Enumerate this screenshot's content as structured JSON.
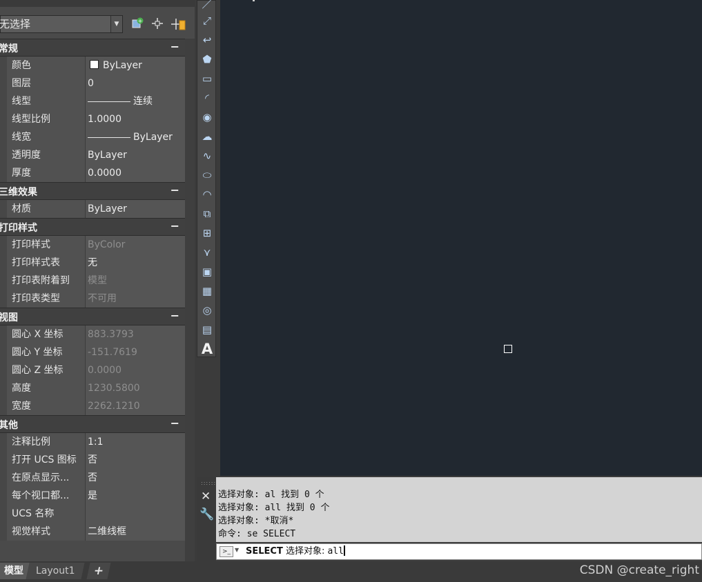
{
  "quick_select": {
    "value": "无选择"
  },
  "toolbar_icons": [
    "add-selected-icon",
    "select-objects-icon",
    "quick-select-icon"
  ],
  "properties": {
    "sections": [
      {
        "title": "常规",
        "collapse": "−",
        "rows": [
          {
            "key": "颜色",
            "value": "ByLayer",
            "kind": "swatch"
          },
          {
            "key": "图层",
            "value": "0"
          },
          {
            "key": "线型",
            "value": "连续",
            "kind": "line"
          },
          {
            "key": "线型比例",
            "value": "1.0000"
          },
          {
            "key": "线宽",
            "value": "ByLayer",
            "kind": "line"
          },
          {
            "key": "透明度",
            "value": "ByLayer"
          },
          {
            "key": "厚度",
            "value": "0.0000"
          }
        ]
      },
      {
        "title": "三维效果",
        "collapse": "−",
        "rows": [
          {
            "key": "材质",
            "value": "ByLayer"
          }
        ]
      },
      {
        "title": "打印样式",
        "collapse": "−",
        "rows": [
          {
            "key": "打印样式",
            "value": "ByColor",
            "dim": true
          },
          {
            "key": "打印样式表",
            "value": "无"
          },
          {
            "key": "打印表附着到",
            "value": "模型",
            "dim": true
          },
          {
            "key": "打印表类型",
            "value": "不可用",
            "dim": true
          }
        ]
      },
      {
        "title": "视图",
        "collapse": "−",
        "rows": [
          {
            "key": "圆心 X 坐标",
            "value": "883.3793",
            "dim": true
          },
          {
            "key": "圆心 Y 坐标",
            "value": "-151.7619",
            "dim": true
          },
          {
            "key": "圆心 Z 坐标",
            "value": "0.0000",
            "dim": true
          },
          {
            "key": "高度",
            "value": "1230.5800",
            "dim": true
          },
          {
            "key": "宽度",
            "value": "2262.1210",
            "dim": true
          }
        ]
      },
      {
        "title": "其他",
        "collapse": "−",
        "rows": [
          {
            "key": "注释比例",
            "value": "1:1"
          },
          {
            "key": "打开 UCS 图标",
            "value": "否"
          },
          {
            "key": "在原点显示...",
            "value": "否"
          },
          {
            "key": "每个视口都...",
            "value": "是"
          },
          {
            "key": "UCS 名称",
            "value": ""
          },
          {
            "key": "视觉样式",
            "value": "二维线框"
          }
        ]
      }
    ]
  },
  "draw_toolbar": [
    "line-icon",
    "construction-line-icon",
    "polyline-icon",
    "polygon-icon",
    "rectangle-icon",
    "arc-icon",
    "circle-icon",
    "revision-cloud-icon",
    "spline-icon",
    "ellipse-icon",
    "ellipse-arc-icon",
    "insert-block-icon",
    "make-block-icon",
    "point-icon",
    "hatch-icon",
    "gradient-icon",
    "region-icon",
    "table-icon",
    "multiline-text-icon"
  ],
  "command_line": {
    "history": [
      "选择对象: al 找到 0 个",
      "选择对象: all 找到 0 个",
      "选择对象: *取消*",
      "命令: se SELECT"
    ],
    "current_command": "SELECT",
    "current_prompt": "选择对象: ",
    "current_input": "all"
  },
  "layout_tabs": {
    "model": "模型",
    "layout1": "Layout1",
    "add": "+"
  },
  "watermark": "CSDN @create_right",
  "colors": {
    "canvas": "#212830",
    "panel": "#4a4a4a",
    "command_history_bg": "#d4d4d4"
  }
}
